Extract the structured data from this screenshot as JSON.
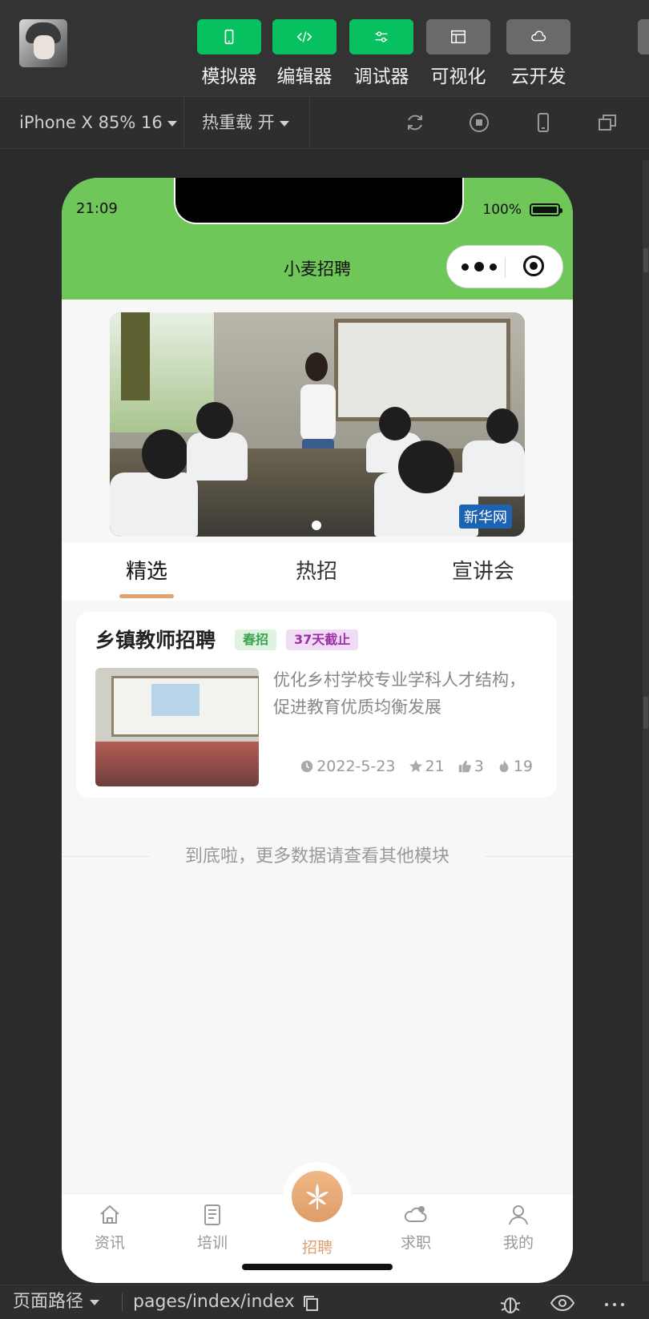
{
  "toolbar": {
    "tools": [
      {
        "label": "模拟器",
        "icon": "phone-icon",
        "active": true
      },
      {
        "label": "编辑器",
        "icon": "code-icon",
        "active": true
      },
      {
        "label": "调试器",
        "icon": "debug-sliders-icon",
        "active": true
      },
      {
        "label": "可视化",
        "icon": "layout-icon",
        "active": false
      },
      {
        "label": "云开发",
        "icon": "cloud-icon",
        "active": false
      }
    ]
  },
  "subbar": {
    "device": "iPhone X 85% 16",
    "hot_reload": "热重载 开"
  },
  "phone": {
    "time": "21:09",
    "battery": "100%",
    "nav_title": "小麦招聘",
    "banner_watermark": "新华网",
    "tabs": [
      "精选",
      "热招",
      "宣讲会"
    ],
    "active_tab": 0,
    "card": {
      "title": "乡镇教师招聘",
      "tag1": "春招",
      "tag2": "37天截止",
      "desc": "优化乡村学校专业学科人才结构，促进教育优质均衡发展",
      "date": "2022-5-23",
      "stars": "21",
      "likes": "3",
      "hot": "19"
    },
    "end_text": "到底啦，更多数据请查看其他模块",
    "tabbar": [
      "资讯",
      "培训",
      "招聘",
      "求职",
      "我的"
    ]
  },
  "footer": {
    "page_path_label": "页面路径",
    "path": "pages/index/index"
  },
  "colors": {
    "accent_green": "#07c160",
    "nav_green": "#6fc75a",
    "orange": "#e3a26c"
  }
}
